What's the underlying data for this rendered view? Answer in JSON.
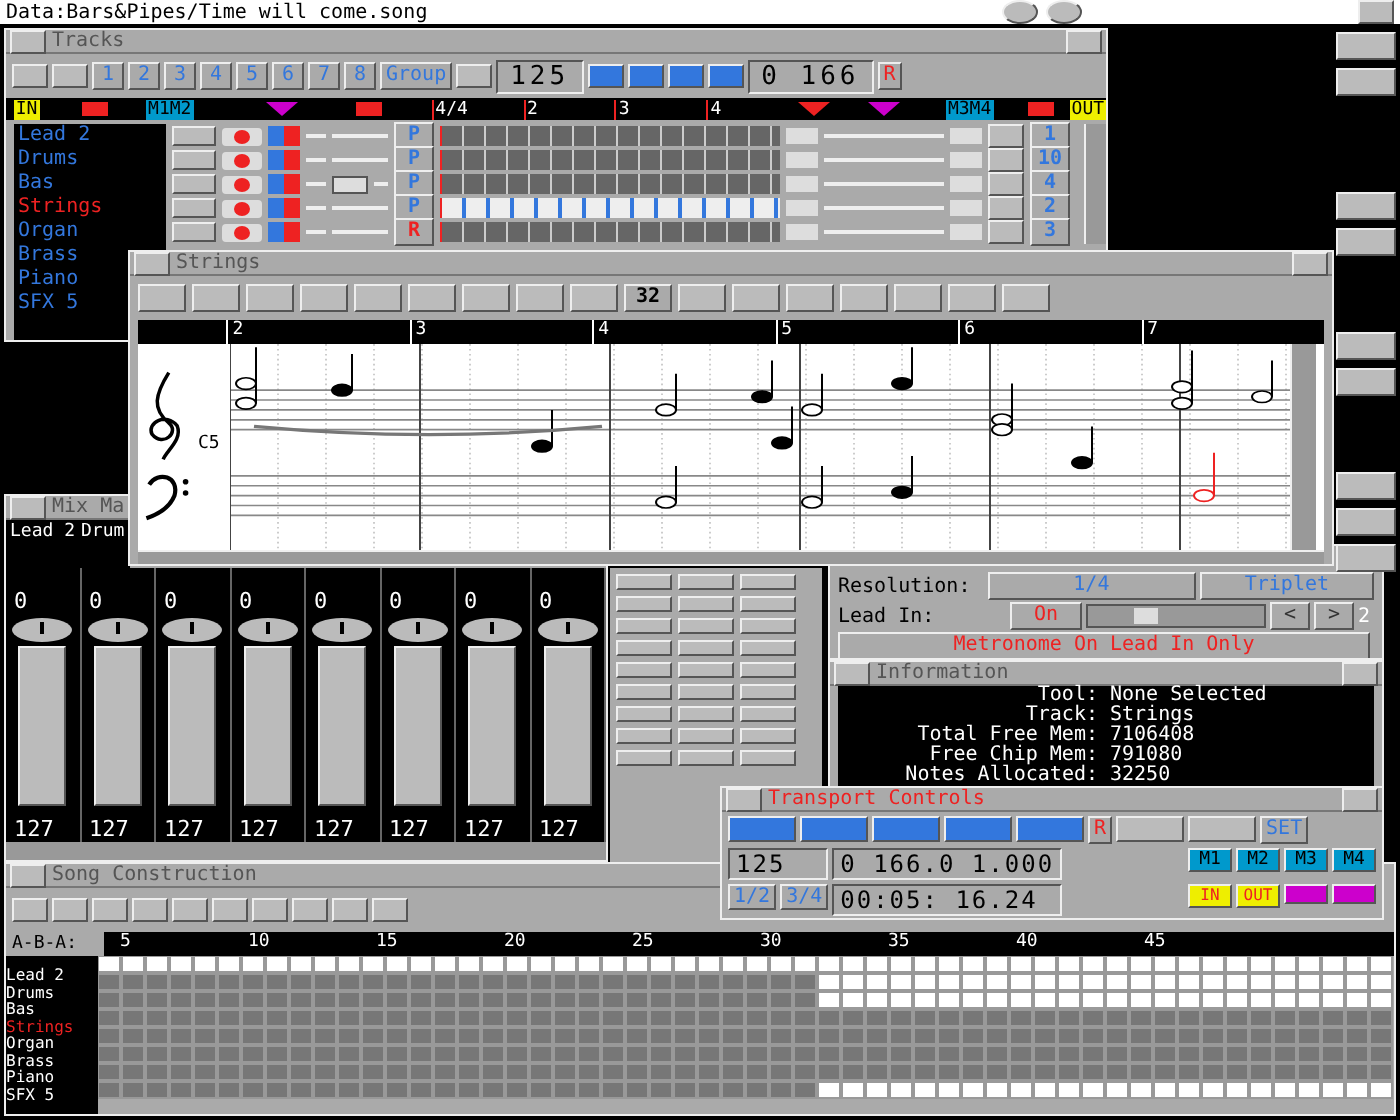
{
  "screen_title": "Data:Bars&Pipes/Time will come.song",
  "tracks_window": {
    "title": "Tracks",
    "groups": [
      "1",
      "2",
      "3",
      "4",
      "5",
      "6",
      "7",
      "8"
    ],
    "group_label": "Group",
    "tempo": "125",
    "position": "0 166",
    "record_label": "R",
    "markers": {
      "in": "IN",
      "left_pair": "M1M2",
      "meter": "4/4",
      "bars": [
        "2",
        "3",
        "4"
      ],
      "right_pair": "M3M4",
      "out": "OUT"
    },
    "tracks": [
      {
        "name": "Lead 2",
        "selected": false,
        "mode": "P",
        "recording": false,
        "channel": "1"
      },
      {
        "name": "Drums",
        "selected": false,
        "mode": "P",
        "recording": false,
        "channel": "10"
      },
      {
        "name": "Bas",
        "selected": false,
        "mode": "P",
        "recording": false,
        "channel": "4",
        "tools": [
          {
            "kind": "transpose"
          }
        ]
      },
      {
        "name": "Strings",
        "selected": true,
        "mode": "P",
        "recording": false,
        "channel": "2"
      },
      {
        "name": "Organ",
        "selected": false,
        "mode": "R",
        "recording": true,
        "channel": "3"
      },
      {
        "name": "Brass",
        "selected": false
      },
      {
        "name": "Piano",
        "selected": false
      },
      {
        "name": "SFX 5",
        "selected": false
      }
    ]
  },
  "strings_window": {
    "title": "Strings",
    "toolbar_number": "32",
    "bars": [
      "2",
      "3",
      "4",
      "5",
      "6",
      "7"
    ],
    "clef_label": "C5"
  },
  "mix_window": {
    "title": "Mix Ma",
    "strip_labels": [
      "Lead 2",
      "Drum"
    ],
    "channels": [
      {
        "pan": "0",
        "volume": "127"
      },
      {
        "pan": "0",
        "volume": "127"
      },
      {
        "pan": "0",
        "volume": "127"
      },
      {
        "pan": "0",
        "volume": "127"
      },
      {
        "pan": "0",
        "volume": "127"
      },
      {
        "pan": "0",
        "volume": "127"
      },
      {
        "pan": "0",
        "volume": "127"
      },
      {
        "pan": "0",
        "volume": "127"
      }
    ]
  },
  "metronome_window": {
    "resolution_label": "Resolution:",
    "resolution": "1/4",
    "triplet": "Triplet",
    "lead_in_label": "Lead In:",
    "lead_in": "On",
    "lead_in_slider": {
      "level": 0.3
    },
    "arrows": [
      "<",
      ">"
    ],
    "lead_in_bars": "2",
    "mode": "Metronome On Lead In Only"
  },
  "information_window": {
    "title": "Information",
    "fields": [
      {
        "label": "Tool:",
        "value": "None Selected"
      },
      {
        "label": "Track:",
        "value": "Strings"
      },
      {
        "label": "Total Free Mem:",
        "value": "7106408"
      },
      {
        "label": "Free Chip Mem:",
        "value": "791080"
      },
      {
        "label": "Notes Allocated:",
        "value": "32250"
      }
    ]
  },
  "transport_window": {
    "title": "Transport Controls",
    "record_label": "R",
    "set_label": "SET",
    "tempo": "125",
    "position": "0 166.0 1.000",
    "time": "00:05: 16.24",
    "meters": [
      "1/2",
      "3/4"
    ],
    "markers": [
      "M1",
      "M2",
      "M3",
      "M4"
    ],
    "punch": [
      "IN",
      "OUT"
    ]
  },
  "song_window": {
    "title": "Song Construction",
    "form": "A-B-A:",
    "bars": [
      "5",
      "10",
      "15",
      "20",
      "25",
      "30",
      "35",
      "40",
      "45"
    ],
    "tracks": [
      {
        "name": "Lead 2",
        "selected": false
      },
      {
        "name": "Drums",
        "selected": false
      },
      {
        "name": "Bas",
        "selected": false
      },
      {
        "name": "Strings",
        "selected": true
      },
      {
        "name": "Organ",
        "selected": false
      },
      {
        "name": "Brass",
        "selected": false
      },
      {
        "name": "Piano",
        "selected": false
      },
      {
        "name": "SFX 5",
        "selected": false
      }
    ]
  }
}
